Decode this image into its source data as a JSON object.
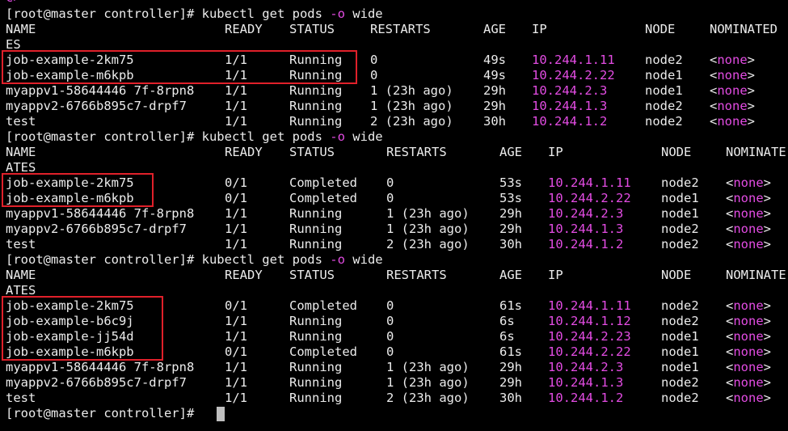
{
  "terminal": {
    "top_fragment": "c>",
    "blocks": [
      {
        "command": {
          "prompt": "[root@master controller]# ",
          "cmd": "kubectl get pods ",
          "flag": "-o",
          "arg": " wide"
        },
        "header": {
          "name": "NAME",
          "ready": "READY",
          "status": "STATUS",
          "restarts": "RESTARTS",
          "age": "AGE",
          "ip": "IP",
          "node": "NODE",
          "nominated": "NOMINATED",
          "wrap": "ES"
        },
        "rows": [
          {
            "name": "job-example-2km75",
            "ready": "1/1",
            "status": "Running",
            "restarts": "0",
            "age": "49s",
            "ip": "10.244.1.11",
            "node": "node2",
            "nominated": "none"
          },
          {
            "name": "job-example-m6kpb",
            "ready": "1/1",
            "status": "Running",
            "restarts": "0",
            "age": "49s",
            "ip": "10.244.2.22",
            "node": "node1",
            "nominated": "none"
          },
          {
            "name": "myappv1-58644446 7f-8rpn8",
            "ready": "1/1",
            "status": "Running",
            "restarts": "1 (23h ago)",
            "age": "29h",
            "ip": "10.244.2.3",
            "node": "node1",
            "nominated": "none"
          },
          {
            "name": "myappv2-6766b895c7-drpf7",
            "ready": "1/1",
            "status": "Running",
            "restarts": "1 (23h ago)",
            "age": "29h",
            "ip": "10.244.1.3",
            "node": "node2",
            "nominated": "none"
          },
          {
            "name": "test",
            "ready": "1/1",
            "status": "Running",
            "restarts": "2 (23h ago)",
            "age": "30h",
            "ip": "10.244.1.2",
            "node": "node2",
            "nominated": "none"
          }
        ]
      },
      {
        "command": {
          "prompt": "[root@master controller]# ",
          "cmd": "kubectl get pods ",
          "flag": "-o",
          "arg": " wide"
        },
        "header": {
          "name": "NAME",
          "ready": "READY",
          "status": "STATUS",
          "restarts": "RESTARTS",
          "age": "AGE",
          "ip": "IP",
          "node": "NODE",
          "nominated": "NOMINATE",
          "wrap": "ATES"
        },
        "rows": [
          {
            "name": "job-example-2km75",
            "ready": "0/1",
            "status": "Completed",
            "restarts": "0",
            "age": "53s",
            "ip": "10.244.1.11",
            "node": "node2",
            "nominated": "none"
          },
          {
            "name": "job-example-m6kpb",
            "ready": "0/1",
            "status": "Completed",
            "restarts": "0",
            "age": "53s",
            "ip": "10.244.2.22",
            "node": "node1",
            "nominated": "none"
          },
          {
            "name": "myappv1-58644446 7f-8rpn8",
            "ready": "1/1",
            "status": "Running",
            "restarts": "1 (23h ago)",
            "age": "29h",
            "ip": "10.244.2.3",
            "node": "node1",
            "nominated": "none"
          },
          {
            "name": "myappv2-6766b895c7-drpf7",
            "ready": "1/1",
            "status": "Running",
            "restarts": "1 (23h ago)",
            "age": "29h",
            "ip": "10.244.1.3",
            "node": "node2",
            "nominated": "none"
          },
          {
            "name": "test",
            "ready": "1/1",
            "status": "Running",
            "restarts": "2 (23h ago)",
            "age": "30h",
            "ip": "10.244.1.2",
            "node": "node2",
            "nominated": "none"
          }
        ]
      },
      {
        "command": {
          "prompt": "[root@master controller]# ",
          "cmd": "kubectl get pods ",
          "flag": "-o",
          "arg": " wide"
        },
        "header": {
          "name": "NAME",
          "ready": "READY",
          "status": "STATUS",
          "restarts": "RESTARTS",
          "age": "AGE",
          "ip": "IP",
          "node": "NODE",
          "nominated": "NOMINATE",
          "wrap": "ATES"
        },
        "rows": [
          {
            "name": "job-example-2km75",
            "ready": "0/1",
            "status": "Completed",
            "restarts": "0",
            "age": "61s",
            "ip": "10.244.1.11",
            "node": "node2",
            "nominated": "none"
          },
          {
            "name": "job-example-b6c9j",
            "ready": "1/1",
            "status": "Running",
            "restarts": "0",
            "age": "6s",
            "ip": "10.244.1.12",
            "node": "node2",
            "nominated": "none"
          },
          {
            "name": "job-example-jj54d",
            "ready": "1/1",
            "status": "Running",
            "restarts": "0",
            "age": "6s",
            "ip": "10.244.2.23",
            "node": "node1",
            "nominated": "none"
          },
          {
            "name": "job-example-m6kpb",
            "ready": "0/1",
            "status": "Completed",
            "restarts": "0",
            "age": "61s",
            "ip": "10.244.2.22",
            "node": "node1",
            "nominated": "none"
          },
          {
            "name": "myappv1-58644446 7f-8rpn8",
            "ready": "1/1",
            "status": "Running",
            "restarts": "1 (23h ago)",
            "age": "29h",
            "ip": "10.244.2.3",
            "node": "node1",
            "nominated": "none"
          },
          {
            "name": "myappv2-6766b895c7-drpf7",
            "ready": "1/1",
            "status": "Running",
            "restarts": "1 (23h ago)",
            "age": "29h",
            "ip": "10.244.1.3",
            "node": "node2",
            "nominated": "none"
          },
          {
            "name": "test",
            "ready": "1/1",
            "status": "Running",
            "restarts": "2 (23h ago)",
            "age": "30h",
            "ip": "10.244.1.2",
            "node": "node2",
            "nominated": "none"
          }
        ]
      }
    ],
    "final_prompt": "[root@master controller]# ",
    "lt": "<",
    "gt": ">",
    "colors": {
      "background": "#000000",
      "text": "#ececec",
      "ip": "#e34ce3",
      "highlight_box": "#e0202a",
      "cursor": "#bfbfbf"
    }
  }
}
